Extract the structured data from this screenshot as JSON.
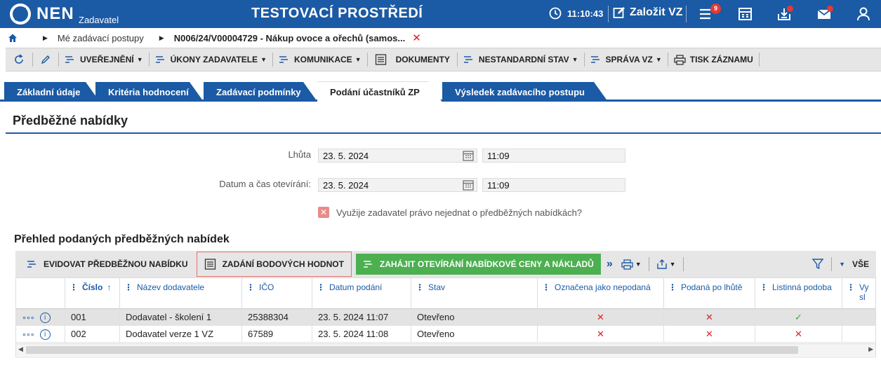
{
  "app": {
    "logo": "NEN",
    "logo_sub": "Zadavatel",
    "env_title": "TESTOVACÍ PROSTŘEDÍ",
    "clock": "11:10:43",
    "new_vz": "Založit VZ",
    "menu_badge": "9"
  },
  "breadcrumb": {
    "item1": "Mé zadávací postupy",
    "item2": "N006/24/V00004729 - Nákup ovoce a ořechů (samos...",
    "close": "✕"
  },
  "toolbar": {
    "publish": "UVEŘEJNĚNÍ",
    "actions": "ÚKONY ZADAVATELE",
    "communication": "KOMUNIKACE",
    "documents": "DOKUMENTY",
    "nonstandard": "NESTANDARDNÍ STAV",
    "manage": "SPRÁVA VZ",
    "print": "TISK ZÁZNAMU"
  },
  "tabs": [
    {
      "label": "Základní údaje"
    },
    {
      "label": "Kritéria hodnocení"
    },
    {
      "label": "Zadávací podmínky"
    },
    {
      "label": "Podání účastníků ZP"
    },
    {
      "label": "Výsledek zadávacího postupu"
    }
  ],
  "section": {
    "title": "Předběžné nabídky"
  },
  "form": {
    "deadline_label": "Lhůta",
    "deadline_date": "23. 5. 2024",
    "deadline_time": "11:09",
    "opening_label": "Datum a čas otevírání:",
    "opening_date": "23. 5. 2024",
    "opening_time": "11:09",
    "checkbox_label": "Využije zadavatel právo nejednat o předběžných nabídkách?",
    "checkbox_mark": "✕"
  },
  "grid": {
    "title": "Přehled podaných předběžných nabídek",
    "btn_register": "EVIDOVAT PŘEDBĚŽNOU NABÍDKU",
    "btn_points": "ZADÁNÍ BODOVÝCH HODNOT",
    "btn_open": "ZAHÁJIT OTEVÍRÁNÍ NABÍDKOVÉ CENY A NÁKLADŮ",
    "more": "»",
    "filter_all": "VŠE",
    "columns": {
      "number": "Číslo",
      "sort": "↑",
      "supplier": "Název dodavatele",
      "ico": "IČO",
      "date": "Datum podání",
      "status": "Stav",
      "not_submitted": "Označena jako nepodaná",
      "late": "Podaná po lhůtě",
      "paper": "Listinná podoba",
      "extra1": "Vy",
      "extra2": "sl"
    },
    "rows": [
      {
        "number": "001",
        "supplier": "Dodavatel - školení 1",
        "ico": "25388304",
        "date": "23. 5. 2024 11:07",
        "status": "Otevřeno",
        "not_submitted": "✕",
        "late": "✕",
        "paper": "✓"
      },
      {
        "number": "002",
        "supplier": "Dodavatel verze 1 VZ",
        "ico": "67589",
        "date": "23. 5. 2024 11:08",
        "status": "Otevřeno",
        "not_submitted": "✕",
        "late": "✕",
        "paper": "✕"
      }
    ],
    "row_dots": "∘∘∘",
    "row_info": "i"
  },
  "colors": {
    "brand": "#1b5aa5",
    "green": "#4caf50",
    "red": "#d8232a"
  }
}
